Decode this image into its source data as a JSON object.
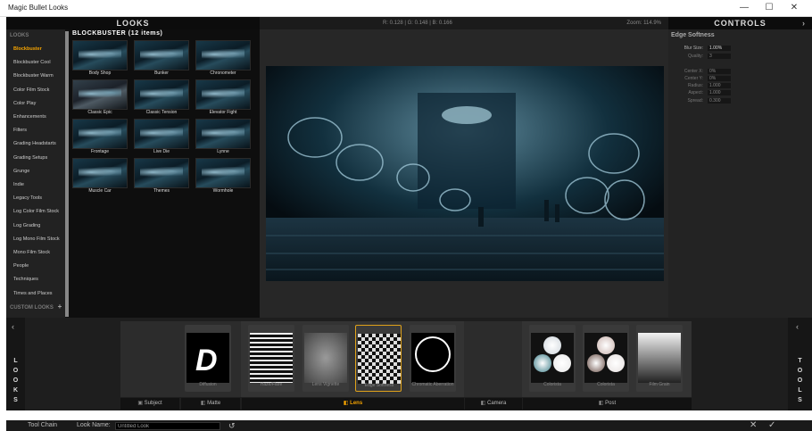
{
  "window": {
    "title": "Magic Bullet Looks",
    "min_glyph": "—",
    "max_glyph": "☐",
    "close_glyph": "✕"
  },
  "header": {
    "looks_title": "LOOKS",
    "readout": "R: 0.128 | G: 0.148 | B: 0.166",
    "zoom": "Zoom: 114.9%",
    "controls_title": "CONTROLS",
    "controls_arrow": "›"
  },
  "categories": {
    "heading": "LOOKS",
    "custom_label": "CUSTOM LOOKS",
    "custom_add": "+",
    "items": [
      "Blockbuster",
      "Blockbuster Cool",
      "Blockbuster Warm",
      "Color Film Stock",
      "Color Play",
      "Enhancements",
      "Filters",
      "Grading Headstarts",
      "Grading Setups",
      "Grunge",
      "Indie",
      "Legacy Tools",
      "Log Color Film Stock",
      "Log Grading",
      "Log Mono Film Stock",
      "Mono Film Stock",
      "People",
      "Techniques",
      "Times and Places"
    ]
  },
  "thumbs": {
    "title": "BLOCKBUSTER (12 items)",
    "items": [
      "Body Shop",
      "Bunker",
      "Chronometer",
      "Classic Epic",
      "Classic Tension",
      "Elevator Fight",
      "Frontage",
      "Live Die",
      "Lynne",
      "Muscle Car",
      "Themes",
      "Wormhole"
    ]
  },
  "controls": {
    "section": "Edge Softness",
    "fields": [
      {
        "label": "Blur Size:",
        "value": "1.00%",
        "bright": true
      },
      {
        "label": "Quality:",
        "value": "3",
        "bright": false
      },
      {
        "label": "Center X:",
        "value": "0%",
        "bright": false
      },
      {
        "label": "Center Y:",
        "value": "0%",
        "bright": false
      },
      {
        "label": "Radius:",
        "value": "1.000",
        "bright": false
      },
      {
        "label": "Aspect:",
        "value": "1.000",
        "bright": false
      },
      {
        "label": "Spread:",
        "value": "0.300",
        "bright": false
      }
    ]
  },
  "side_tabs": {
    "left": "LOOKS",
    "right": "TOOLS",
    "left_chevron": "‹",
    "right_chevron": "‹"
  },
  "tools": [
    {
      "name": "Diffusion",
      "glyph": "D"
    },
    {
      "name": "Haze/Flare"
    },
    {
      "name": "Lens Vignette"
    },
    {
      "name": "Edge Softness"
    },
    {
      "name": "Chromatic Aberration"
    },
    {
      "name": "Colorista"
    },
    {
      "name": "Colorista"
    },
    {
      "name": "Film Grain"
    }
  ],
  "stages": [
    "Subject",
    "Matte",
    "Lens",
    "Camera",
    "Post"
  ],
  "bottom": {
    "tool_chain": "Tool Chain",
    "look_name_label": "Look Name:",
    "look_name_value": "Untitled Look",
    "reset_glyph": "↺",
    "cancel_glyph": "✕",
    "ok_glyph": "✓"
  },
  "colors": {
    "accent": "#f5a300",
    "panel": "#222222",
    "viewer": "#272727"
  }
}
